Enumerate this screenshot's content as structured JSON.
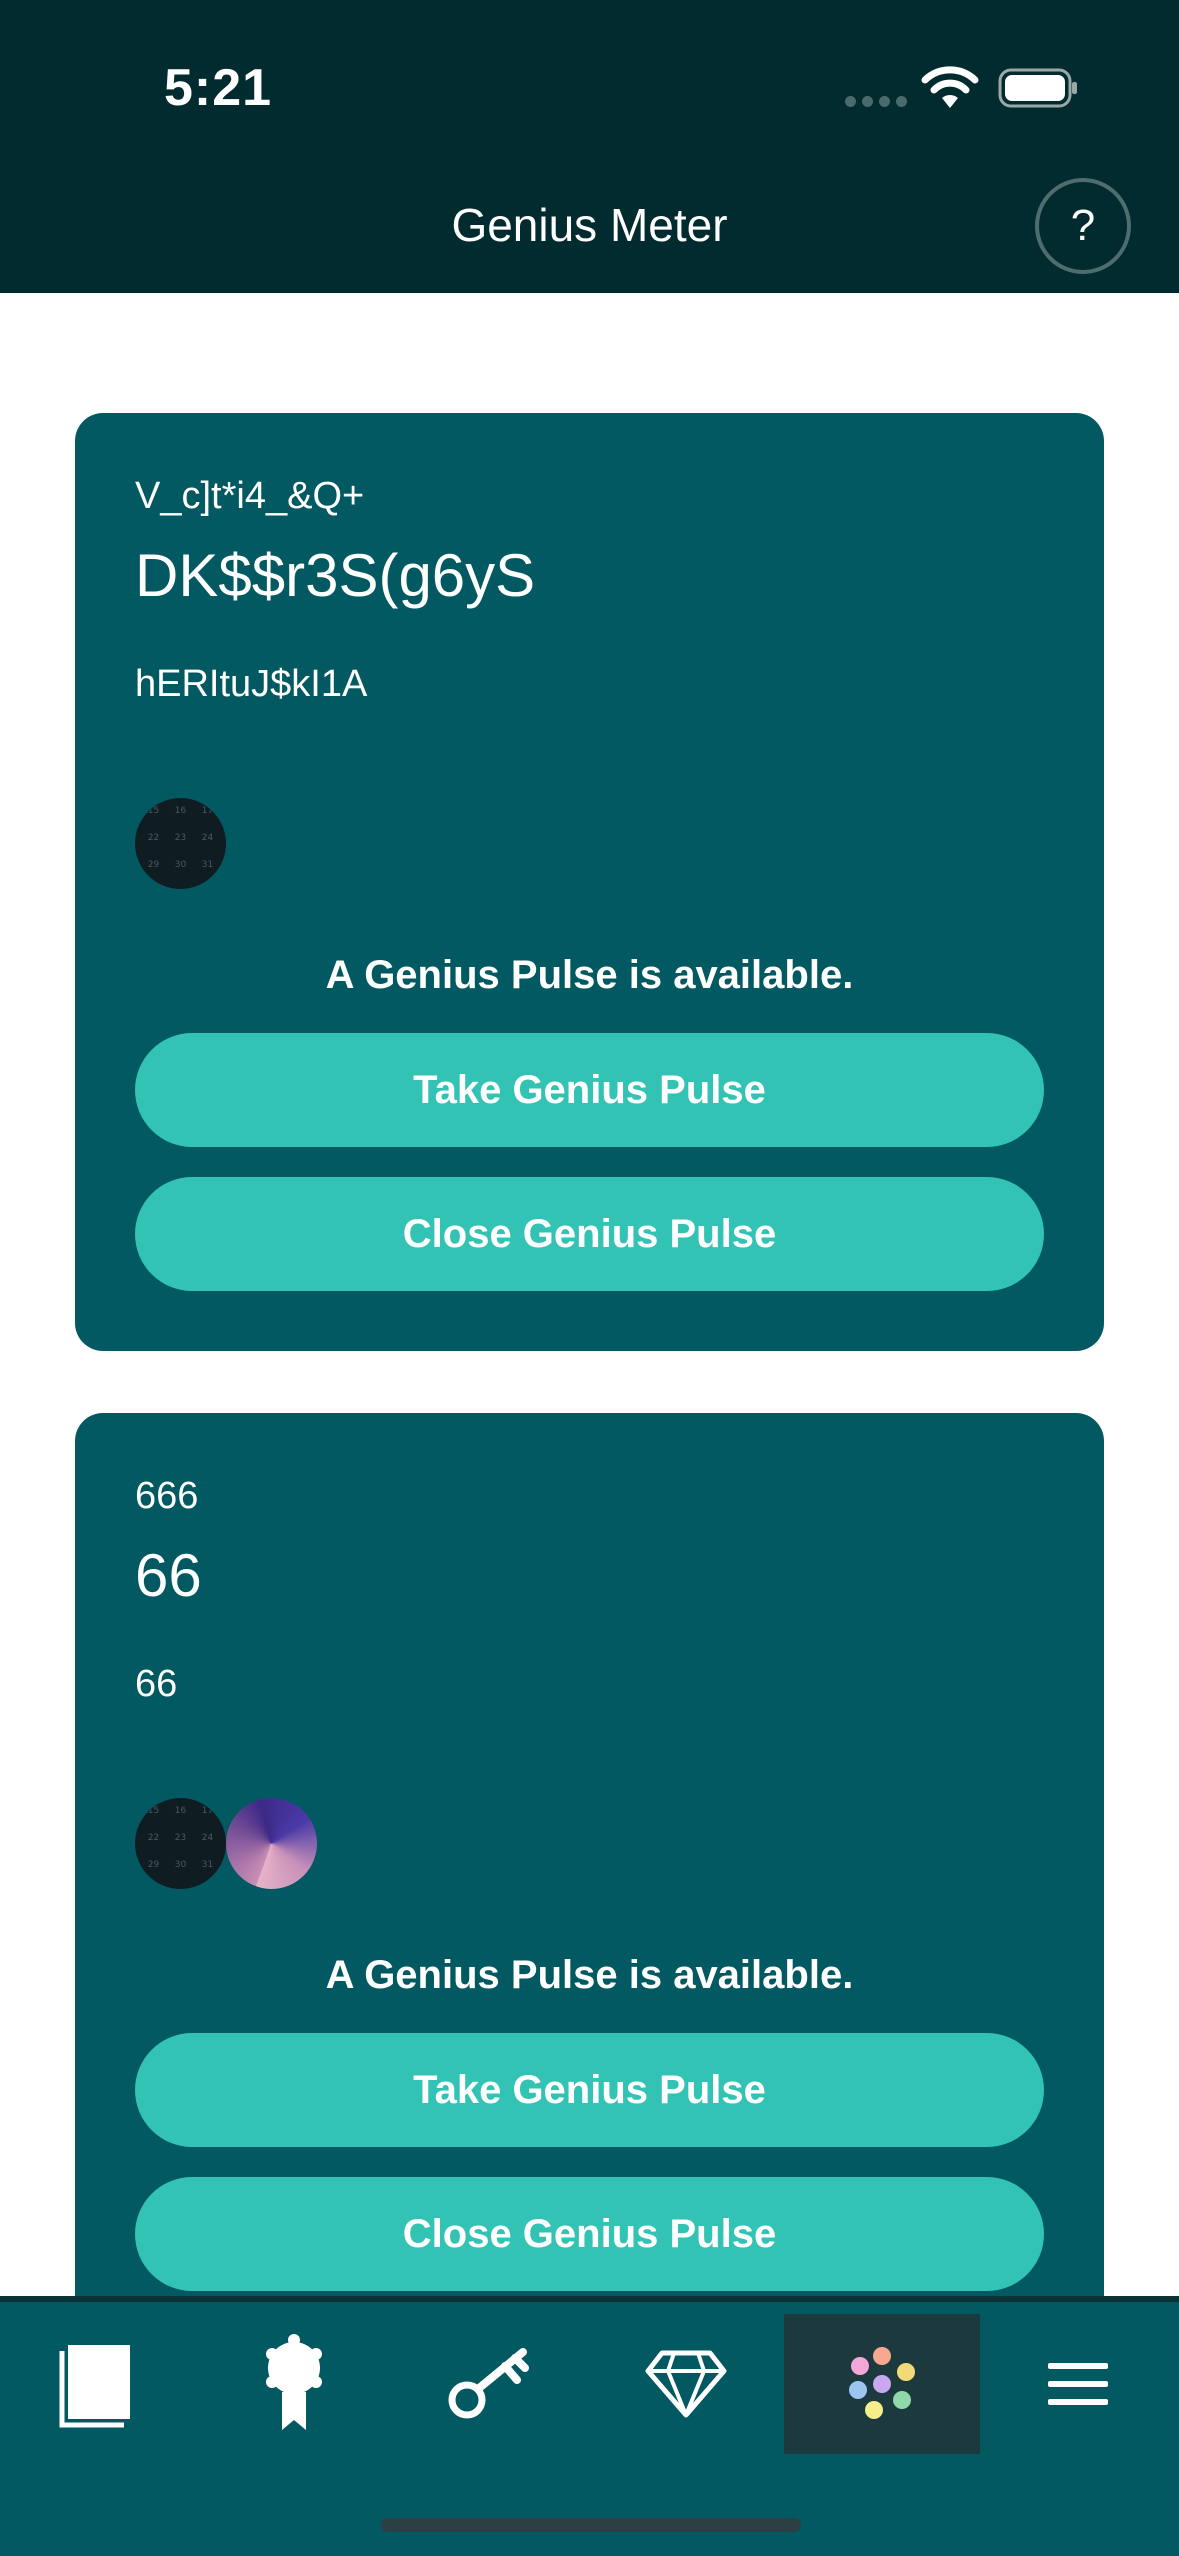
{
  "status_bar": {
    "time": "5:21"
  },
  "header": {
    "title": "Genius Meter",
    "help_label": "?"
  },
  "cards": [
    {
      "eyebrow": "V_c]t*i4_&Q+",
      "title": "DK$$r3S(g6yS",
      "subtitle": "hERItuJ$kI1A",
      "avatars": [
        "calendar-avatar"
      ],
      "pulse_note": "A Genius Pulse is available.",
      "take_label": "Take Genius Pulse",
      "close_label": "Close Genius Pulse"
    },
    {
      "eyebrow": "666",
      "title": "66",
      "subtitle": "66",
      "avatars": [
        "calendar-avatar",
        "artwork-avatar"
      ],
      "pulse_note": "A Genius Pulse is available.",
      "take_label": "Take Genius Pulse",
      "close_label": "Close Genius Pulse"
    }
  ],
  "calendar_digits": [
    "15",
    "16",
    "17",
    "22",
    "23",
    "24",
    "29",
    "30",
    "31"
  ],
  "tabbar": {
    "items": [
      {
        "icon": "book-icon"
      },
      {
        "icon": "award-ribbon-icon"
      },
      {
        "icon": "key-icon"
      },
      {
        "icon": "diamond-icon"
      },
      {
        "icon": "flower-dots-icon",
        "active": true
      },
      {
        "icon": "menu-icon"
      }
    ]
  },
  "colors": {
    "header_bg": "#012b2e",
    "card_bg": "#025961",
    "button_bg": "#32c3b4",
    "tab_active_bg": "#1c3a3e"
  }
}
